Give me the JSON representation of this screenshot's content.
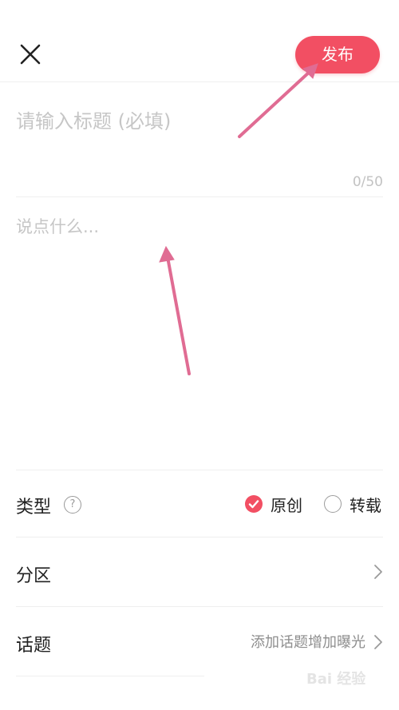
{
  "header": {
    "publish_label": "发布"
  },
  "title_field": {
    "placeholder": "请输入标题 (必填)",
    "value": "",
    "counter": "0/50"
  },
  "content_field": {
    "placeholder": "说点什么...",
    "value": ""
  },
  "type_row": {
    "label": "类型",
    "help_glyph": "?",
    "options": [
      {
        "label": "原创",
        "selected": true
      },
      {
        "label": "转载",
        "selected": false
      }
    ]
  },
  "partition_row": {
    "label": "分区"
  },
  "topic_row": {
    "label": "话题",
    "hint": "添加话题增加曝光"
  },
  "watermark": "Bai 经验",
  "colors": {
    "accent": "#f24f63",
    "annotation_arrow": "#e06c93"
  }
}
